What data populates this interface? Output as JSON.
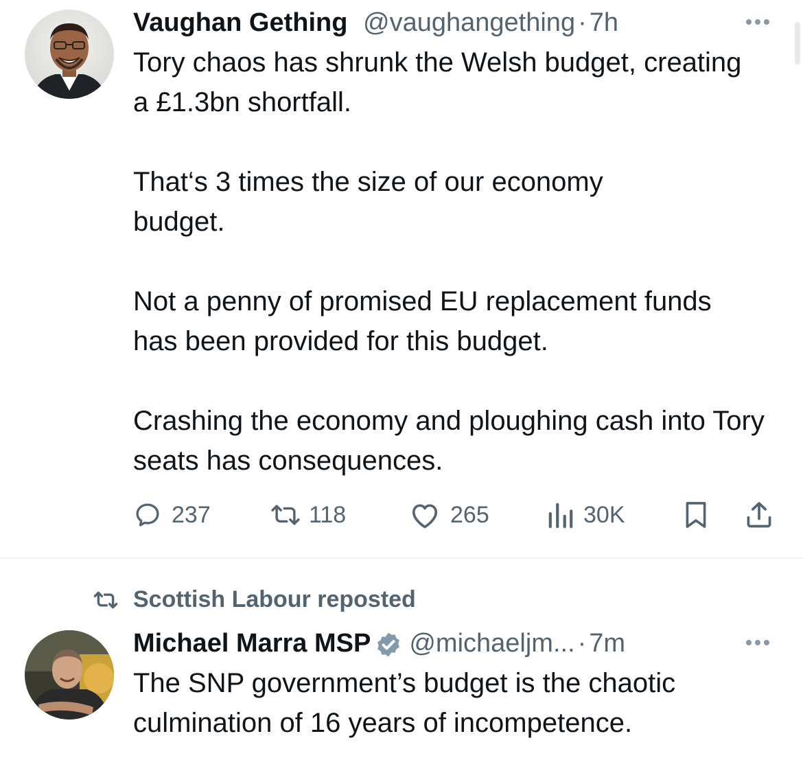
{
  "tweets": [
    {
      "author": {
        "name": "Vaughan Gething",
        "handle": "@vaughangething",
        "separator": "·",
        "time": "7h",
        "avatar_icon": "person-portrait-icon"
      },
      "paragraphs": [
        "Tory chaos has shrunk the Welsh budget, creating a £1.3bn shortfall.",
        "That‘s 3 times the size of our economy budget.",
        "Not a penny of promised EU replacement funds has been provided for this budget.",
        "Crashing the economy and ploughing cash into Tory seats has consequences."
      ],
      "stats": {
        "replies": "237",
        "reposts": "118",
        "likes": "265",
        "views": "30K"
      },
      "icons": [
        "reply-icon",
        "repost-icon",
        "like-icon",
        "views-icon",
        "bookmark-icon",
        "share-icon",
        "more-icon"
      ]
    },
    {
      "social_context": "Scottish Labour reposted",
      "author": {
        "name": "Michael Marra MSP",
        "handle": "@michaeljm...",
        "separator": "·",
        "time": "7m",
        "verified": true,
        "avatar_icon": "person-portrait-icon"
      },
      "paragraphs": [
        "The SNP government’s budget is the chaotic culmination of 16 years of incompetence."
      ]
    }
  ],
  "colors": {
    "text": "#0f1419",
    "secondary": "#536471",
    "divider": "#eff3f4",
    "verified_badge": "#829aab"
  }
}
